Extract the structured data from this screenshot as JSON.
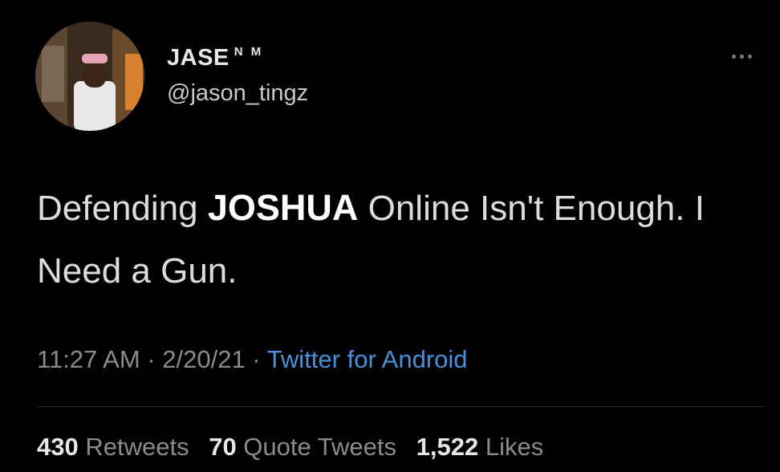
{
  "user": {
    "display_name": "JASE",
    "name_badge": "N M",
    "handle": "@jason_tingz",
    "avatar_icon": "user-photo-avatar"
  },
  "tweet": {
    "text_before": "Defending ",
    "highlight": "JOSHUA",
    "text_after": " Online Isn't Enough. I Need a Gun."
  },
  "meta": {
    "time": "11:27 AM",
    "separator": " · ",
    "date": "2/20/21",
    "source": "Twitter for Android"
  },
  "stats": {
    "retweets": {
      "count": "430",
      "label": " Retweets"
    },
    "quotes": {
      "count": "70",
      "label": " Quote Tweets"
    },
    "likes": {
      "count": "1,522",
      "label": " Likes"
    }
  },
  "colors": {
    "background": "#000000",
    "link": "#4a90d9",
    "muted": "#8b8b8b"
  }
}
